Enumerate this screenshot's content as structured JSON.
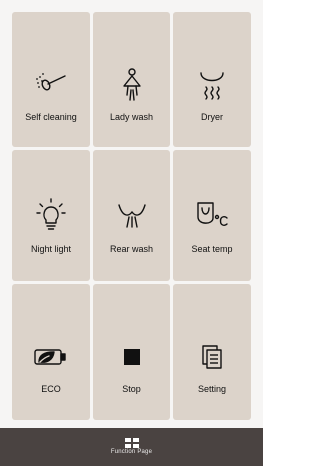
{
  "tiles": [
    {
      "label": "Self cleaning",
      "icon": "self-cleaning-icon"
    },
    {
      "label": "Lady wash",
      "icon": "lady-wash-icon"
    },
    {
      "label": "Dryer",
      "icon": "dryer-icon"
    },
    {
      "label": "Night light",
      "icon": "night-light-icon"
    },
    {
      "label": "Rear wash",
      "icon": "rear-wash-icon"
    },
    {
      "label": "Seat temp",
      "icon": "seat-temp-icon"
    },
    {
      "label": "ECO",
      "icon": "eco-battery-icon"
    },
    {
      "label": "Stop",
      "icon": "stop-icon"
    },
    {
      "label": "Setting",
      "icon": "setting-icon"
    }
  ],
  "bottom_bar": {
    "label": "Function Page",
    "icon": "grid-icon"
  },
  "colors": {
    "background": "#f6f5f4",
    "tile": "#dcd3ca",
    "bottom_bar": "#4a4341",
    "icon_stroke": "#111111"
  }
}
